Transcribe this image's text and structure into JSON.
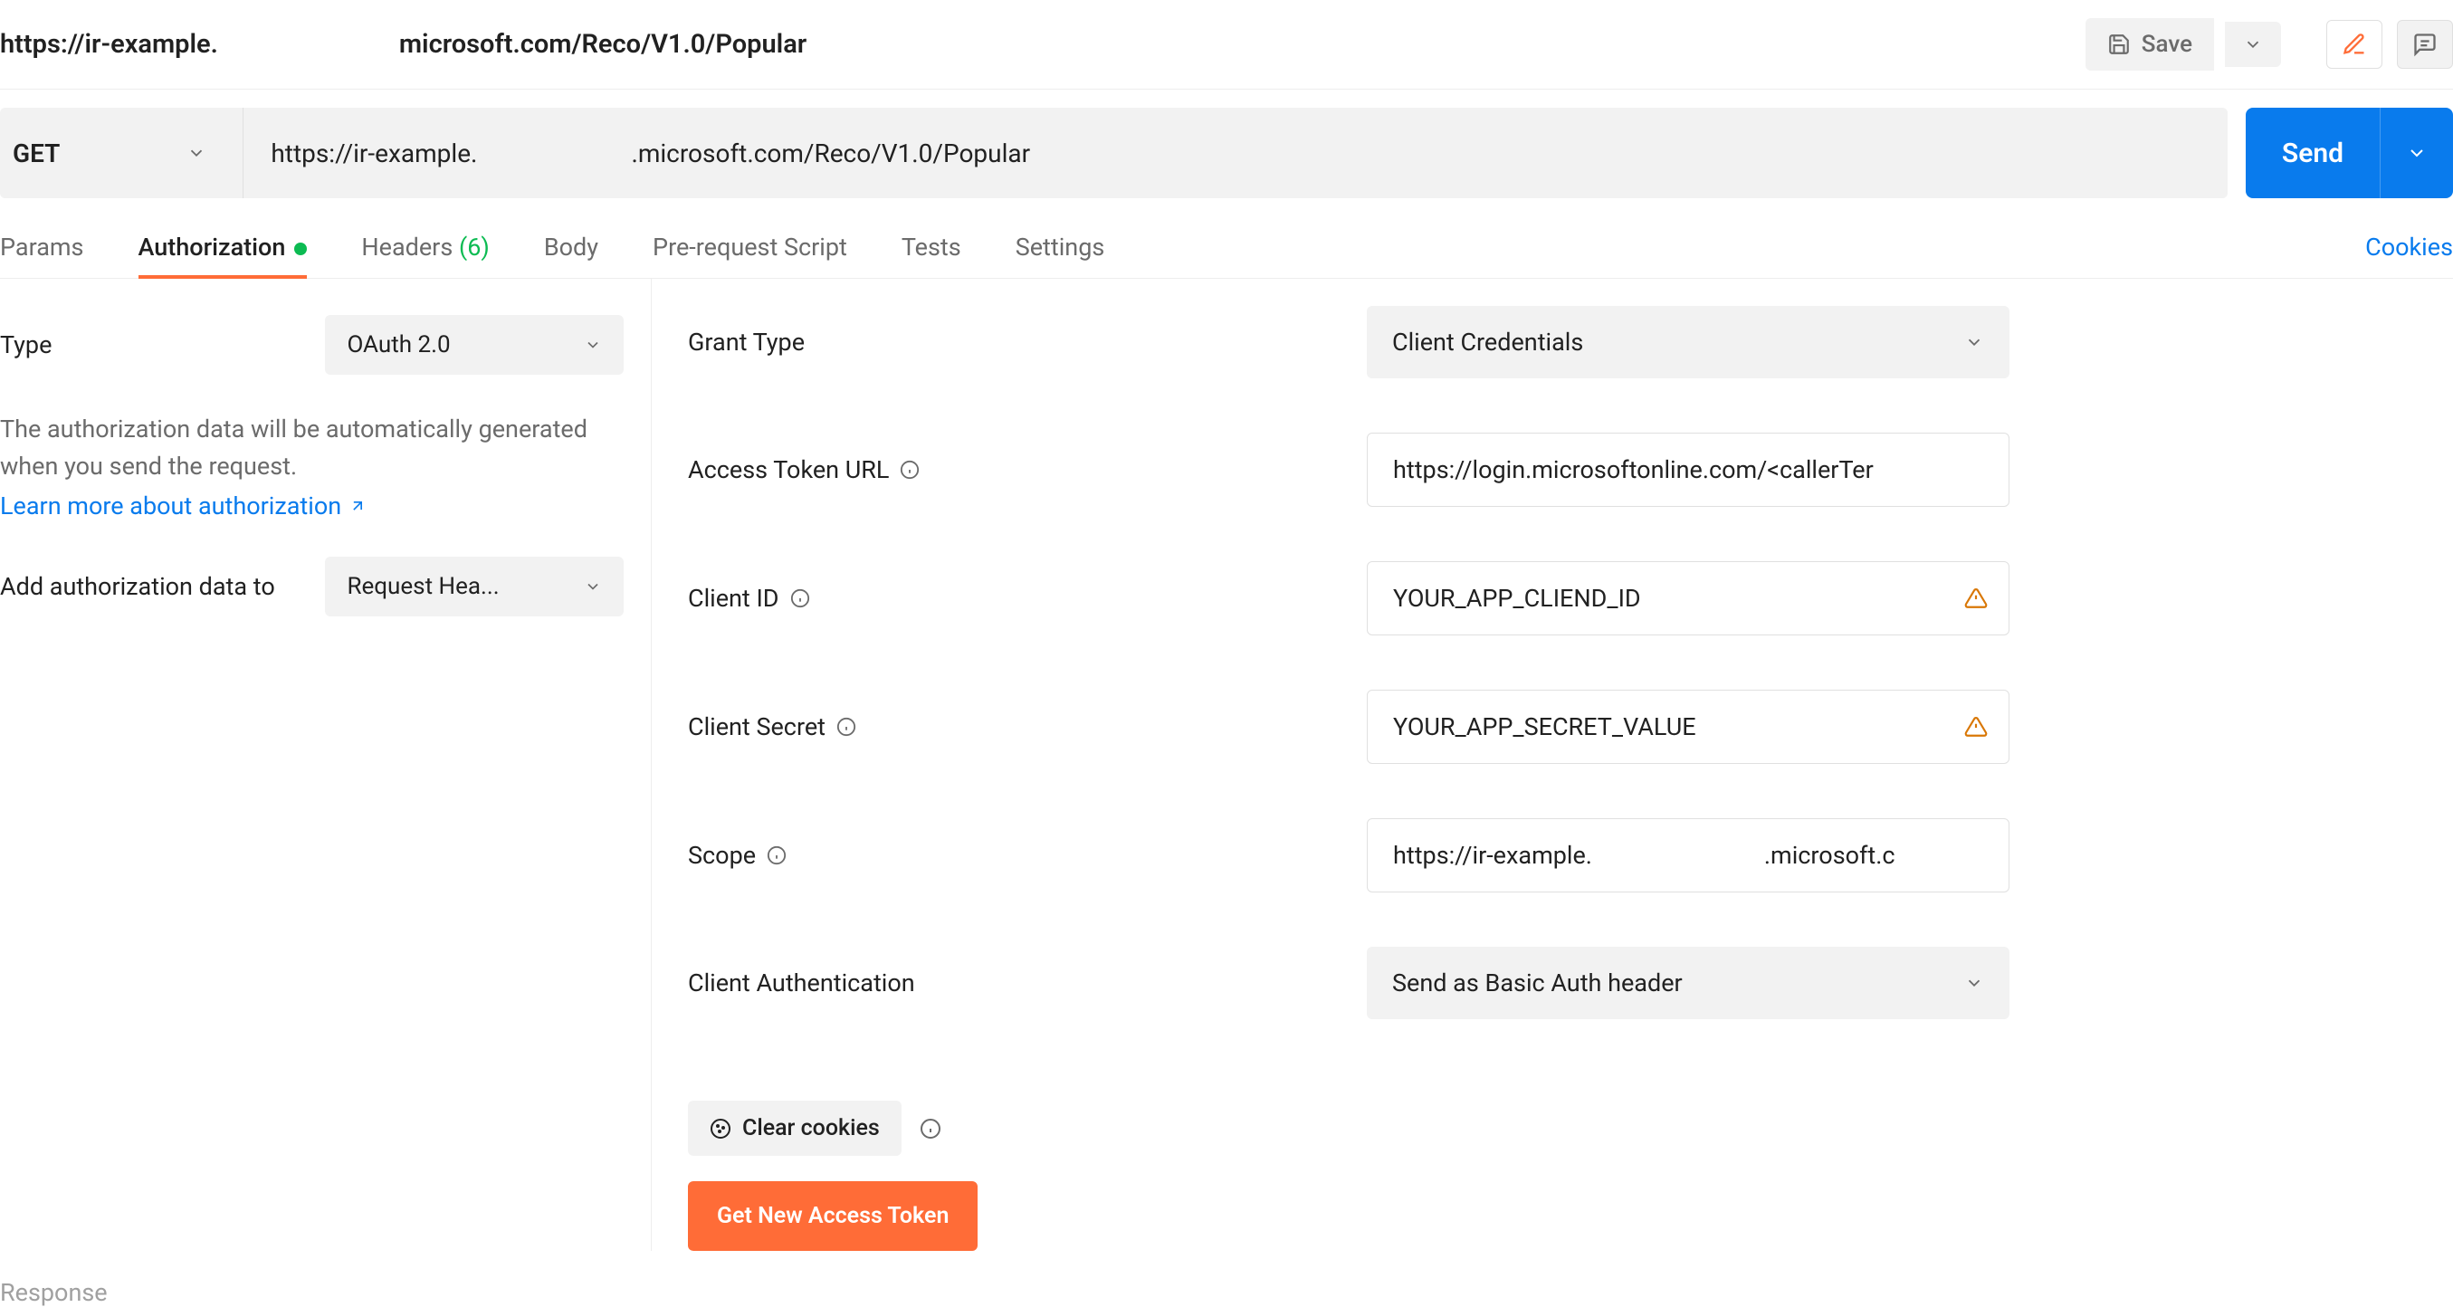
{
  "topbar": {
    "breadcrumb_left": "https://ir-example.",
    "breadcrumb_right": "microsoft.com/Reco/V1.0/Popular",
    "save_label": "Save"
  },
  "request": {
    "method": "GET",
    "url_left": "https://ir-example.",
    "url_right": ".microsoft.com/Reco/V1.0/Popular",
    "send_label": "Send"
  },
  "tabs": {
    "params": "Params",
    "authorization": "Authorization",
    "headers": "Headers",
    "headers_count": "(6)",
    "body": "Body",
    "prerequest": "Pre-request Script",
    "tests": "Tests",
    "settings": "Settings",
    "cookies": "Cookies"
  },
  "left": {
    "type_label": "Type",
    "type_value": "OAuth 2.0",
    "desc": "The authorization data will be automatically generated when you send the request.",
    "learn_more": "Learn more about authorization",
    "add_to_label": "Add authorization data to",
    "add_to_value": "Request Hea..."
  },
  "form": {
    "grant_type_label": "Grant Type",
    "grant_type_value": "Client Credentials",
    "access_token_url_label": "Access Token URL",
    "access_token_url_value": "https://login.microsoftonline.com/<callerTer",
    "client_id_label": "Client ID",
    "client_id_value": "YOUR_APP_CLIEND_ID",
    "client_secret_label": "Client Secret",
    "client_secret_value": "YOUR_APP_SECRET_VALUE",
    "scope_label": "Scope",
    "scope_value_left": "https://ir-example.",
    "scope_value_right": ".microsoft.c",
    "client_auth_label": "Client Authentication",
    "client_auth_value": "Send as Basic Auth header",
    "clear_cookies_label": "Clear cookies",
    "get_token_label": "Get New Access Token"
  },
  "response_label": "Response"
}
